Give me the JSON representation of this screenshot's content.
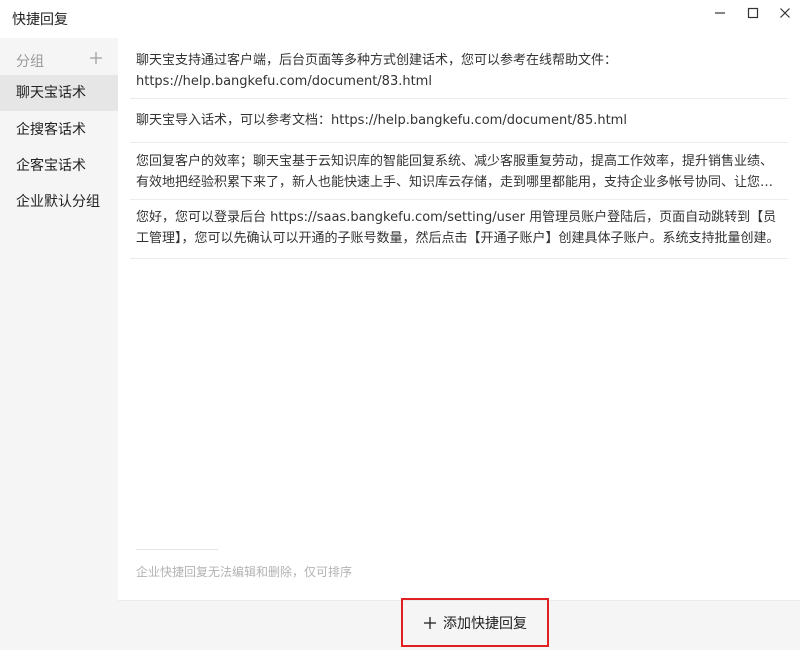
{
  "window": {
    "title": "快捷回复"
  },
  "sidebar": {
    "group_label": "分组",
    "items": [
      {
        "label": "聊天宝话术",
        "active": true
      },
      {
        "label": "企搜客话术",
        "active": false
      },
      {
        "label": "企客宝话术",
        "active": false
      },
      {
        "label": "企业默认分组",
        "active": false
      }
    ]
  },
  "replies": [
    {
      "text": "聊天宝支持通过客户端，后台页面等多种方式创建话术，您可以参考在线帮助文件：https://help.bangkefu.com/document/83.html"
    },
    {
      "text": "聊天宝导入话术，可以参考文档：https://help.bangkefu.com/document/85.html"
    },
    {
      "text": "您回复客户的效率；聊天宝基于云知识库的智能回复系统、减少客服重复劳动，提高工作效率，提升销售业绩、有效地把经验积累下来了，新人也能快速上手、知识库云存储，走到哪里都能用，支持企业多帐号协同、让您…"
    },
    {
      "text": "您好，您可以登录后台 https://saas.bangkefu.com/setting/user 用管理员账户登陆后，页面自动跳转到【员工管理】，您可以先确认可以开通的子账号数量，然后点击【开通子账户】创建具体子账户。系统支持批量创建。"
    }
  ],
  "notice": "企业快捷回复无法编辑和删除，仅可排序",
  "footer": {
    "add_label": "添加快捷回复"
  },
  "colors": {
    "highlight_border": "#e02020",
    "sidebar_bg": "#f5f5f5",
    "active_item_bg": "#e6e6e6"
  }
}
